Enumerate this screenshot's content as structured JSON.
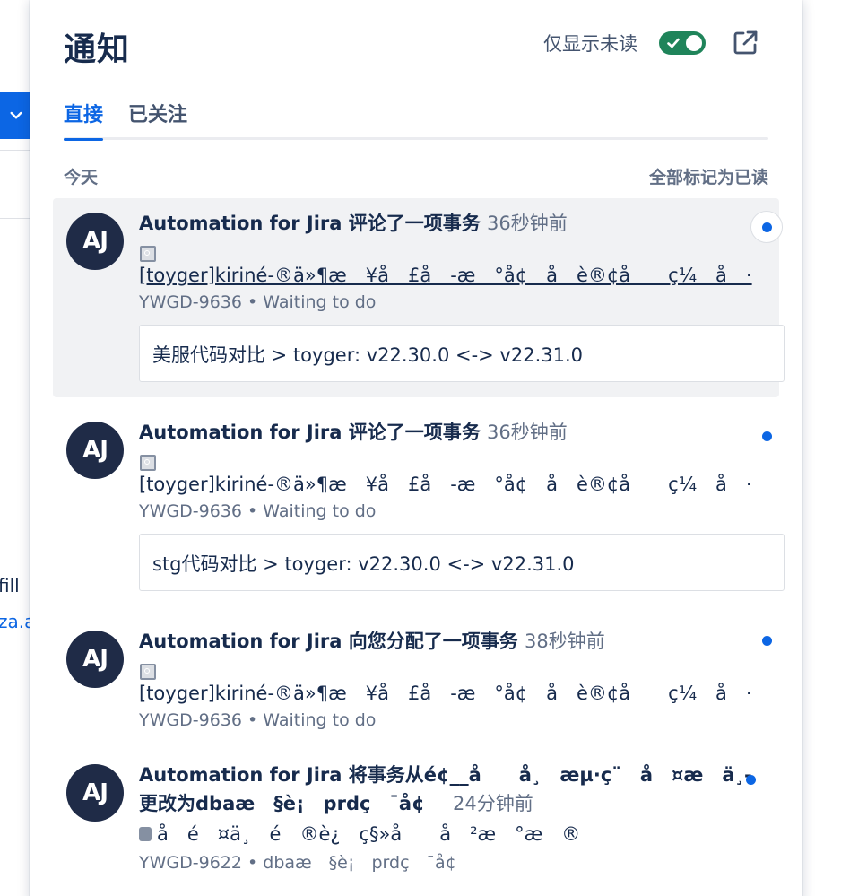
{
  "background": {
    "text_1": "fill",
    "text_2": "za.a"
  },
  "panel": {
    "title": "通知",
    "unread_only_label": "仅显示未读",
    "unread_only_on": true,
    "tabs": [
      {
        "label": "直接",
        "active": true
      },
      {
        "label": "已关注",
        "active": false
      }
    ],
    "section_label": "今天",
    "mark_all_read": "全部标记为已读"
  },
  "notifications": [
    {
      "avatar": "AJ",
      "actor": "Automation for Jira",
      "action": "评论了一项事务",
      "time": "36秒钟前",
      "summary": "[toyger]kiriné-®ä»¶æ　¥å　£å　-æ　°å¢　å　è®¢å　　ç¼　å　·",
      "issue_key": "YWGD-9636",
      "status": "Waiting to do",
      "comment": "美服代码对比 > toyger: v22.30.0 <-> v22.31.0",
      "unread": true
    },
    {
      "avatar": "AJ",
      "actor": "Automation for Jira",
      "action": "评论了一项事务",
      "time": "36秒钟前",
      "summary": "[toyger]kiriné-®ä»¶æ　¥å　£å　-æ　°å¢　å　è®¢å　　ç¼　å　·",
      "issue_key": "YWGD-9636",
      "status": "Waiting to do",
      "comment": "stg代码对比 > toyger: v22.30.0 <-> v22.31.0",
      "unread": true
    },
    {
      "avatar": "AJ",
      "actor": "Automation for Jira",
      "action": "向您分配了一项事务",
      "time": "38秒钟前",
      "summary": "[toyger]kiriné-®ä»¶æ　¥å　£å　-æ　°å¢　å　è®¢å　　ç¼　å　·",
      "issue_key": "YWGD-9636",
      "status": "Waiting to do",
      "unread": true
    },
    {
      "avatar": "AJ",
      "actor": "Automation for Jira",
      "action_line_1": "将事务从é¢__å　　å¸　æµ·ç¨　å　¤æ　ä¸-",
      "action_line_2": "更改为dbaæ　§è¡　prdç　¯å¢",
      "time": "24分钟前",
      "summary": "å　é　¤ä¸　é　®è¿　ç§»å　　å　²æ　°æ　®",
      "issue_key": "YWGD-9622",
      "status": "dbaæ　§è¡　prdç　¯å¢",
      "unread": true
    }
  ]
}
